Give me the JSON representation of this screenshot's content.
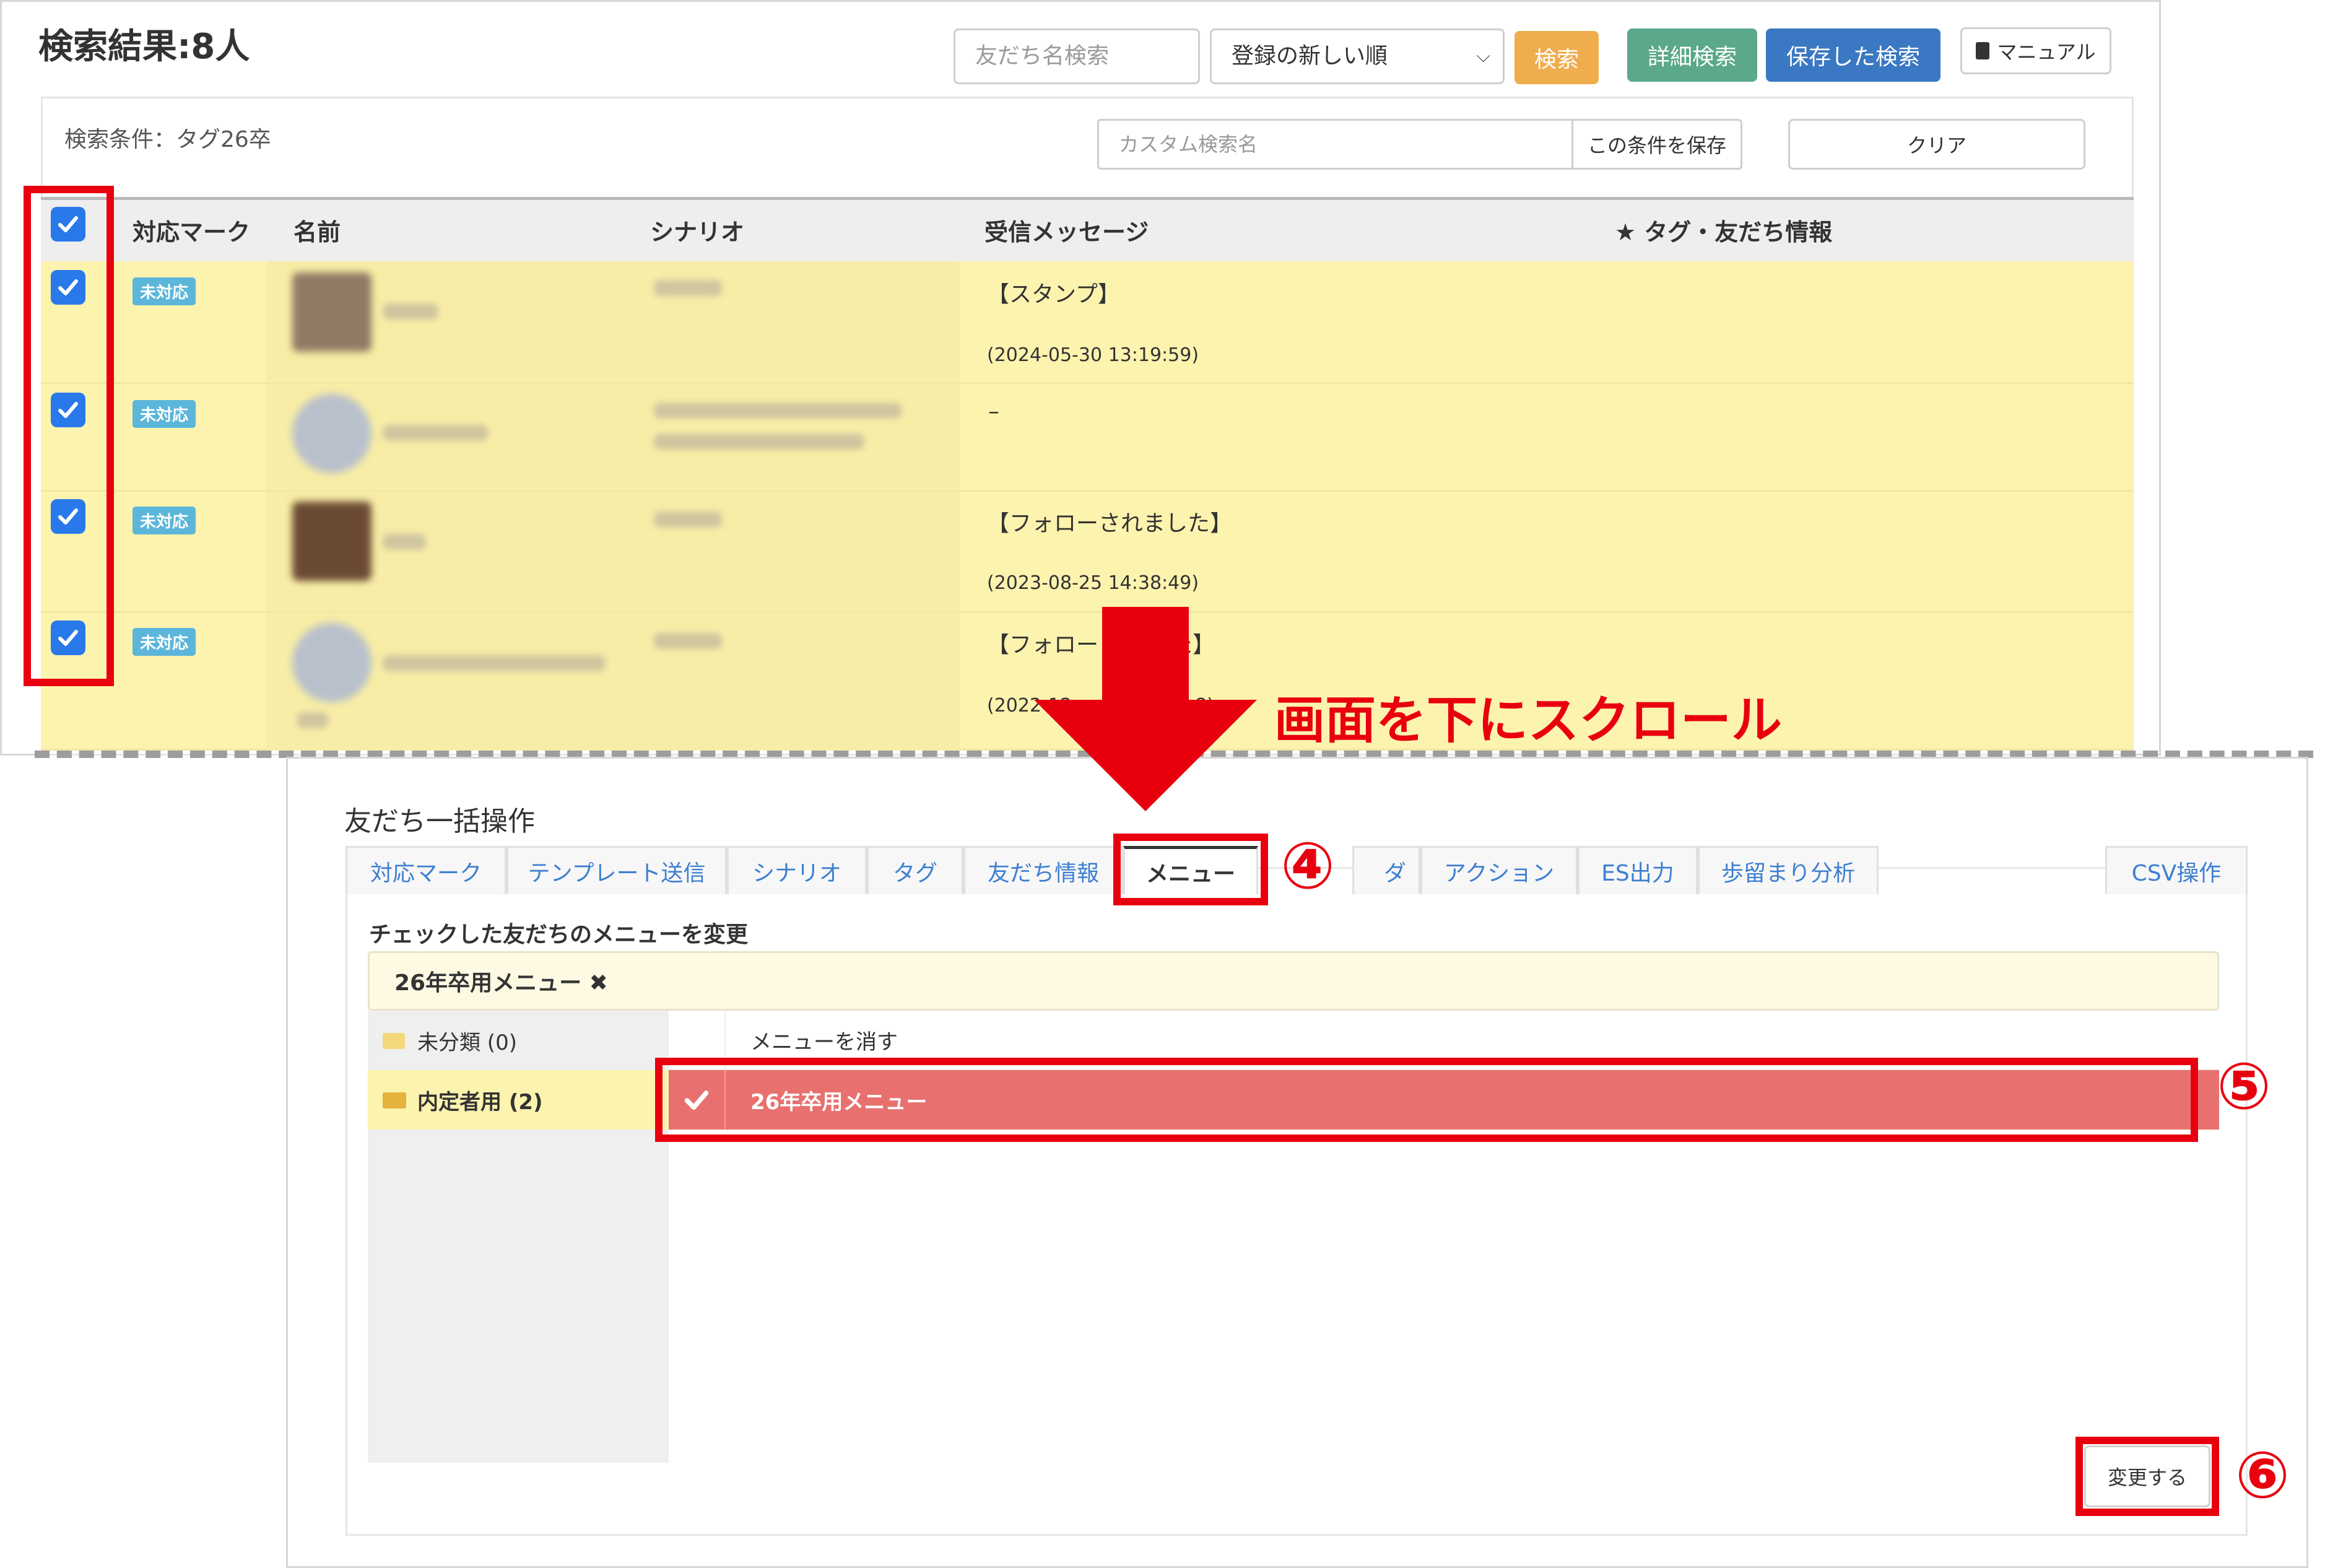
{
  "search": {
    "title": "検索結果:8人",
    "name_placeholder": "友だち名検索",
    "sort_selected": "登録の新しい順",
    "search_label": "検索",
    "detail_search_label": "詳細検索",
    "saved_search_label": "保存した検索",
    "manual_label": "マニュアル",
    "conditions_label": "検索条件：タグ26卒",
    "custom_name_placeholder": "カスタム検索名",
    "save_condition_label": "この条件を保存",
    "clear_label": "クリア"
  },
  "table": {
    "headers": [
      "対応マーク",
      "名前",
      "シナリオ",
      "受信メッセージ",
      "★ タグ・友だち情報"
    ],
    "rows": [
      {
        "badge": "未対応",
        "message": "【スタンプ】",
        "date": "(2024-05-30 13:19:59)"
      },
      {
        "badge": "未対応",
        "message": "–",
        "date": ""
      },
      {
        "badge": "未対応",
        "message": "【フォローされました】",
        "date": "(2023-08-25 14:38:49)"
      },
      {
        "badge": "未対応",
        "message": "【フォロー",
        "message_tail": "た】",
        "date": "(2022-12",
        "date_tail": "8)"
      }
    ]
  },
  "annotation": {
    "scroll_note": "画面を下にスクロール",
    "step4": "④",
    "step5": "⑤",
    "step6": "⑥"
  },
  "bulk": {
    "title": "友だち一括操作",
    "tabs": [
      "対応マーク",
      "テンプレート送信",
      "シナリオ",
      "タグ",
      "友だち情報",
      "メニュー",
      "ダ",
      "アクション",
      "ES出力",
      "歩留まり分析",
      "CSV操作"
    ],
    "active_tab": "メニュー",
    "section_label": "チェックした友だちのメニューを変更",
    "selected_menu": "26年卒用メニュー ✖",
    "folders": [
      {
        "label": "未分類 (0)",
        "selected": false
      },
      {
        "label": "内定者用 (2)",
        "selected": true
      }
    ],
    "menu_items": [
      {
        "label": "メニューを消す",
        "selected": false
      },
      {
        "label": "26年卒用メニュー",
        "selected": true
      }
    ],
    "change_button": "変更する"
  },
  "colors": {
    "accent_red": "#e9000f",
    "checkbox_blue": "#2979ea",
    "row_highlight": "#fcf3ae",
    "selected_menu_row": "#e8716f",
    "search_button": "#f0ad4e",
    "detail_button": "#5ba88a",
    "saved_button": "#3a78c3",
    "badge": "#5bb6d9"
  }
}
